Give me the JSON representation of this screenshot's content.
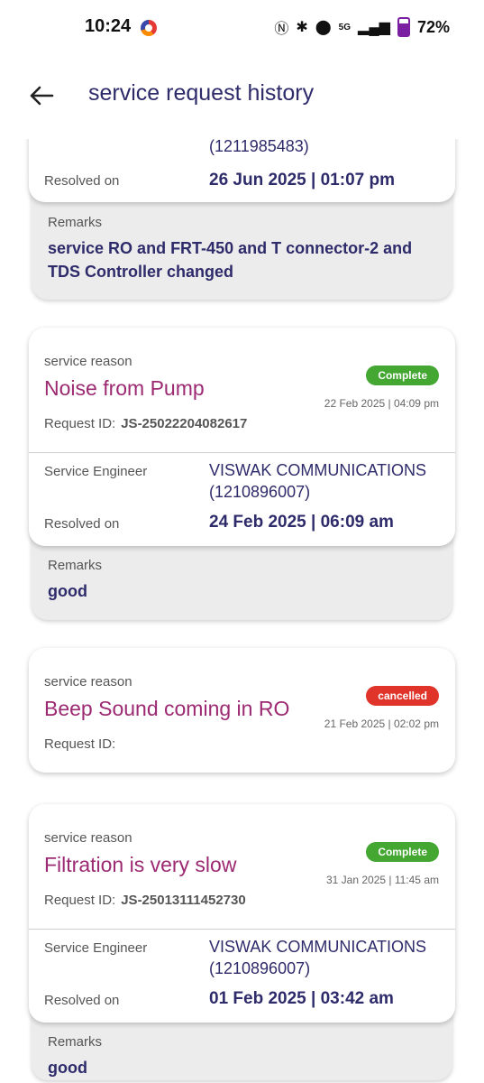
{
  "status_bar": {
    "time": "10:24",
    "network": "5G",
    "battery": "72%"
  },
  "header": {
    "title": "service request history"
  },
  "labels": {
    "service_reason": "service reason",
    "request_id": "Request ID:",
    "service_engineer": "Service Engineer",
    "resolved_on": "Resolved on",
    "remarks": "Remarks"
  },
  "partial": {
    "engineer_id": "(1211985483)",
    "resolved_on": "26 Jun 2025 | 01:07 pm",
    "remarks": "service RO and FRT-450 and T connector-2 and TDS Controller changed"
  },
  "requests": [
    {
      "reason": "Noise from Pump",
      "status": "Complete",
      "date": "22 Feb 2025 | 04:09 pm",
      "request_id": "JS-25022204082617",
      "engineer": "VISWAK COMMUNICATIONS (1210896007)",
      "resolved_on": "24 Feb 2025 | 06:09 am",
      "remarks": "good"
    },
    {
      "reason": "Beep Sound coming in RO",
      "status": "cancelled",
      "date": "21 Feb 2025 | 02:02 pm",
      "request_id": ""
    },
    {
      "reason": "Filtration is very slow",
      "status": "Complete",
      "date": "31 Jan 2025 | 11:45 am",
      "request_id": "JS-25013111452730",
      "engineer": "VISWAK COMMUNICATIONS (1210896007)",
      "resolved_on": "01 Feb 2025 | 03:42 am",
      "remarks": "good"
    }
  ]
}
